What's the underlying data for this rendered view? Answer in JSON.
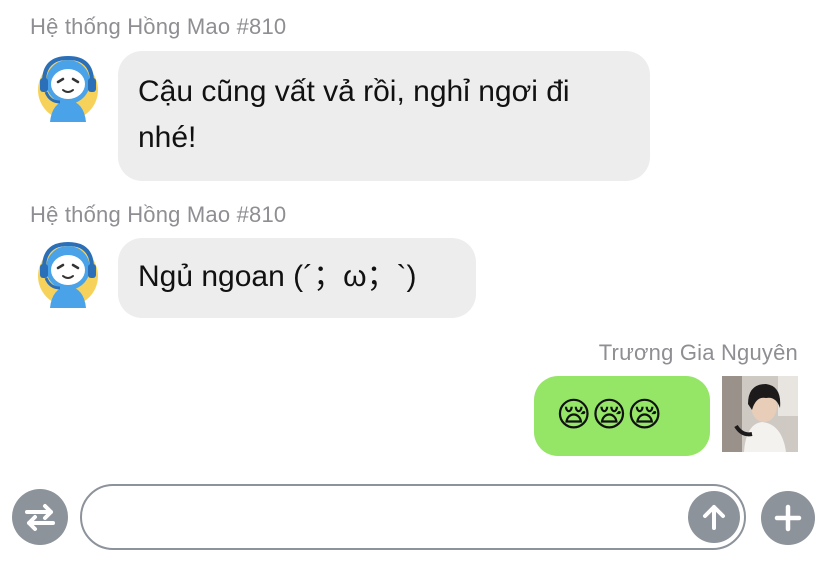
{
  "messages": [
    {
      "sender": "Hệ thống Hồng Mao #810",
      "lines": [
        "Cậu cũng vất vả rồi, nghỉ ngơi đi",
        "nhé!"
      ]
    },
    {
      "sender": "Hệ thống Hồng Mao #810",
      "lines": [
        "Ngủ ngoan (´；ω；`)"
      ]
    },
    {
      "sender": "Trương Gia Nguyên",
      "lines": [
        "😪😪😪"
      ]
    }
  ],
  "input": {
    "value": "",
    "placeholder": ""
  },
  "icons": {
    "bot_avatar": "robot-headset-avatar-icon",
    "switch": "swap-arrows-icon",
    "send": "arrow-up-icon",
    "add": "plus-icon"
  },
  "colors": {
    "incoming_bubble": "#ededed",
    "outgoing_bubble": "#95e567",
    "sender_name": "#8e8e93",
    "control_gray": "#8d939b"
  }
}
